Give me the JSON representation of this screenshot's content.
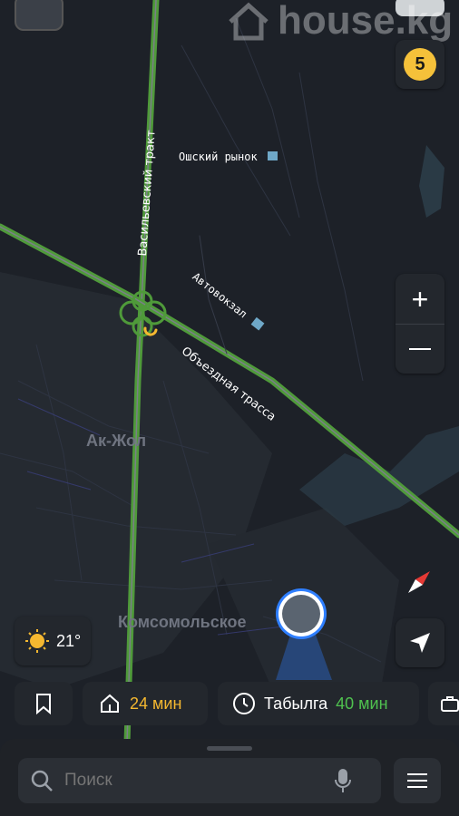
{
  "watermark": "house.kg",
  "badge_count": "5",
  "places": {
    "osh_market": "Ошский рынок",
    "bus_station": "Автовокзал",
    "vasilyev_road": "Васильевский тракт",
    "bypass": "Объездная трасса",
    "ak_zhol": "Ак-Жол",
    "komsomolskoe": "Комсомольское"
  },
  "weather": {
    "temperature": "21°",
    "icon": "sun-icon"
  },
  "chips": {
    "home_time": "24 мин",
    "destination": "Табылга",
    "destination_time": "40 мин"
  },
  "search": {
    "placeholder": "Поиск"
  },
  "colors": {
    "road": "#4f9a3a",
    "time_home": "#f5b830",
    "time_dest": "#4fc14f",
    "accent_blue": "#2f7fff"
  }
}
